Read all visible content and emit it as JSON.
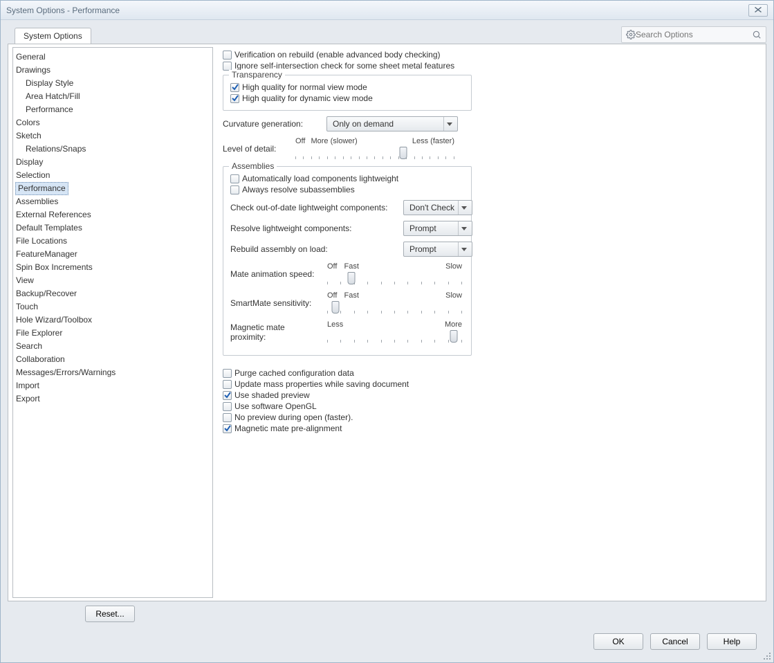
{
  "window": {
    "title": "System Options - Performance"
  },
  "tab": {
    "label": "System Options"
  },
  "search": {
    "placeholder": "Search Options"
  },
  "sidebar": {
    "items": [
      {
        "label": "General",
        "indent": 0
      },
      {
        "label": "Drawings",
        "indent": 0
      },
      {
        "label": "Display Style",
        "indent": 1
      },
      {
        "label": "Area Hatch/Fill",
        "indent": 1
      },
      {
        "label": "Performance",
        "indent": 1
      },
      {
        "label": "Colors",
        "indent": 0
      },
      {
        "label": "Sketch",
        "indent": 0
      },
      {
        "label": "Relations/Snaps",
        "indent": 1
      },
      {
        "label": "Display",
        "indent": 0
      },
      {
        "label": "Selection",
        "indent": 0
      },
      {
        "label": "Performance",
        "indent": 0,
        "selected": true
      },
      {
        "label": "Assemblies",
        "indent": 0
      },
      {
        "label": "External References",
        "indent": 0
      },
      {
        "label": "Default Templates",
        "indent": 0
      },
      {
        "label": "File Locations",
        "indent": 0
      },
      {
        "label": "FeatureManager",
        "indent": 0
      },
      {
        "label": "Spin Box Increments",
        "indent": 0
      },
      {
        "label": "View",
        "indent": 0
      },
      {
        "label": "Backup/Recover",
        "indent": 0
      },
      {
        "label": "Touch",
        "indent": 0
      },
      {
        "label": "Hole Wizard/Toolbox",
        "indent": 0
      },
      {
        "label": "File Explorer",
        "indent": 0
      },
      {
        "label": "Search",
        "indent": 0
      },
      {
        "label": "Collaboration",
        "indent": 0
      },
      {
        "label": "Messages/Errors/Warnings",
        "indent": 0
      },
      {
        "label": "Import",
        "indent": 0
      },
      {
        "label": "Export",
        "indent": 0
      }
    ]
  },
  "checks_top": {
    "verification": {
      "label": "Verification on rebuild (enable advanced body checking)",
      "checked": false
    },
    "ignore_self": {
      "label": "Ignore self-intersection check for some sheet metal features",
      "checked": false
    }
  },
  "transparency": {
    "legend": "Transparency",
    "hq_normal": {
      "label": "High quality for normal view mode",
      "checked": true
    },
    "hq_dynamic": {
      "label": "High quality for dynamic view mode",
      "checked": true
    }
  },
  "curvature": {
    "label": "Curvature generation:",
    "value": "Only on demand"
  },
  "lod": {
    "label": "Level of detail:",
    "left": "Off",
    "mid": "More (slower)",
    "right": "Less (faster)",
    "pos": 68,
    "ticks": 21
  },
  "assemblies": {
    "legend": "Assemblies",
    "auto_light": {
      "label": "Automatically load components lightweight",
      "checked": false
    },
    "always_resolve": {
      "label": "Always resolve subassemblies",
      "checked": false
    },
    "check_ood": {
      "label": "Check out-of-date lightweight components:",
      "value": "Don't Check"
    },
    "resolve_lw": {
      "label": "Resolve lightweight components:",
      "value": "Prompt"
    },
    "rebuild_load": {
      "label": "Rebuild assembly on load:",
      "value": "Prompt"
    },
    "mate_anim": {
      "label": "Mate animation speed:",
      "left": "Off",
      "mid": "Fast",
      "right": "Slow",
      "pos": 18,
      "ticks": 11
    },
    "smartmate": {
      "label": "SmartMate sensitivity:",
      "left": "Off",
      "mid": "Fast",
      "right": "Slow",
      "pos": 6,
      "ticks": 11
    },
    "magnetic_prox": {
      "label": "Magnetic mate proximity:",
      "left": "Less",
      "right": "More",
      "pos": 94,
      "ticks": 11
    }
  },
  "checks_bottom": {
    "purge": {
      "label": "Purge cached configuration data",
      "checked": false
    },
    "update_mass": {
      "label": "Update mass properties while saving document",
      "checked": false
    },
    "shaded_preview": {
      "label": "Use shaded preview",
      "checked": true
    },
    "software_gl": {
      "label": "Use software OpenGL",
      "checked": false
    },
    "no_preview": {
      "label": "No preview during open (faster).",
      "checked": false
    },
    "magnetic_pre": {
      "label": "Magnetic mate pre-alignment",
      "checked": true
    }
  },
  "buttons": {
    "reset": "Reset...",
    "ok": "OK",
    "cancel": "Cancel",
    "help": "Help"
  }
}
